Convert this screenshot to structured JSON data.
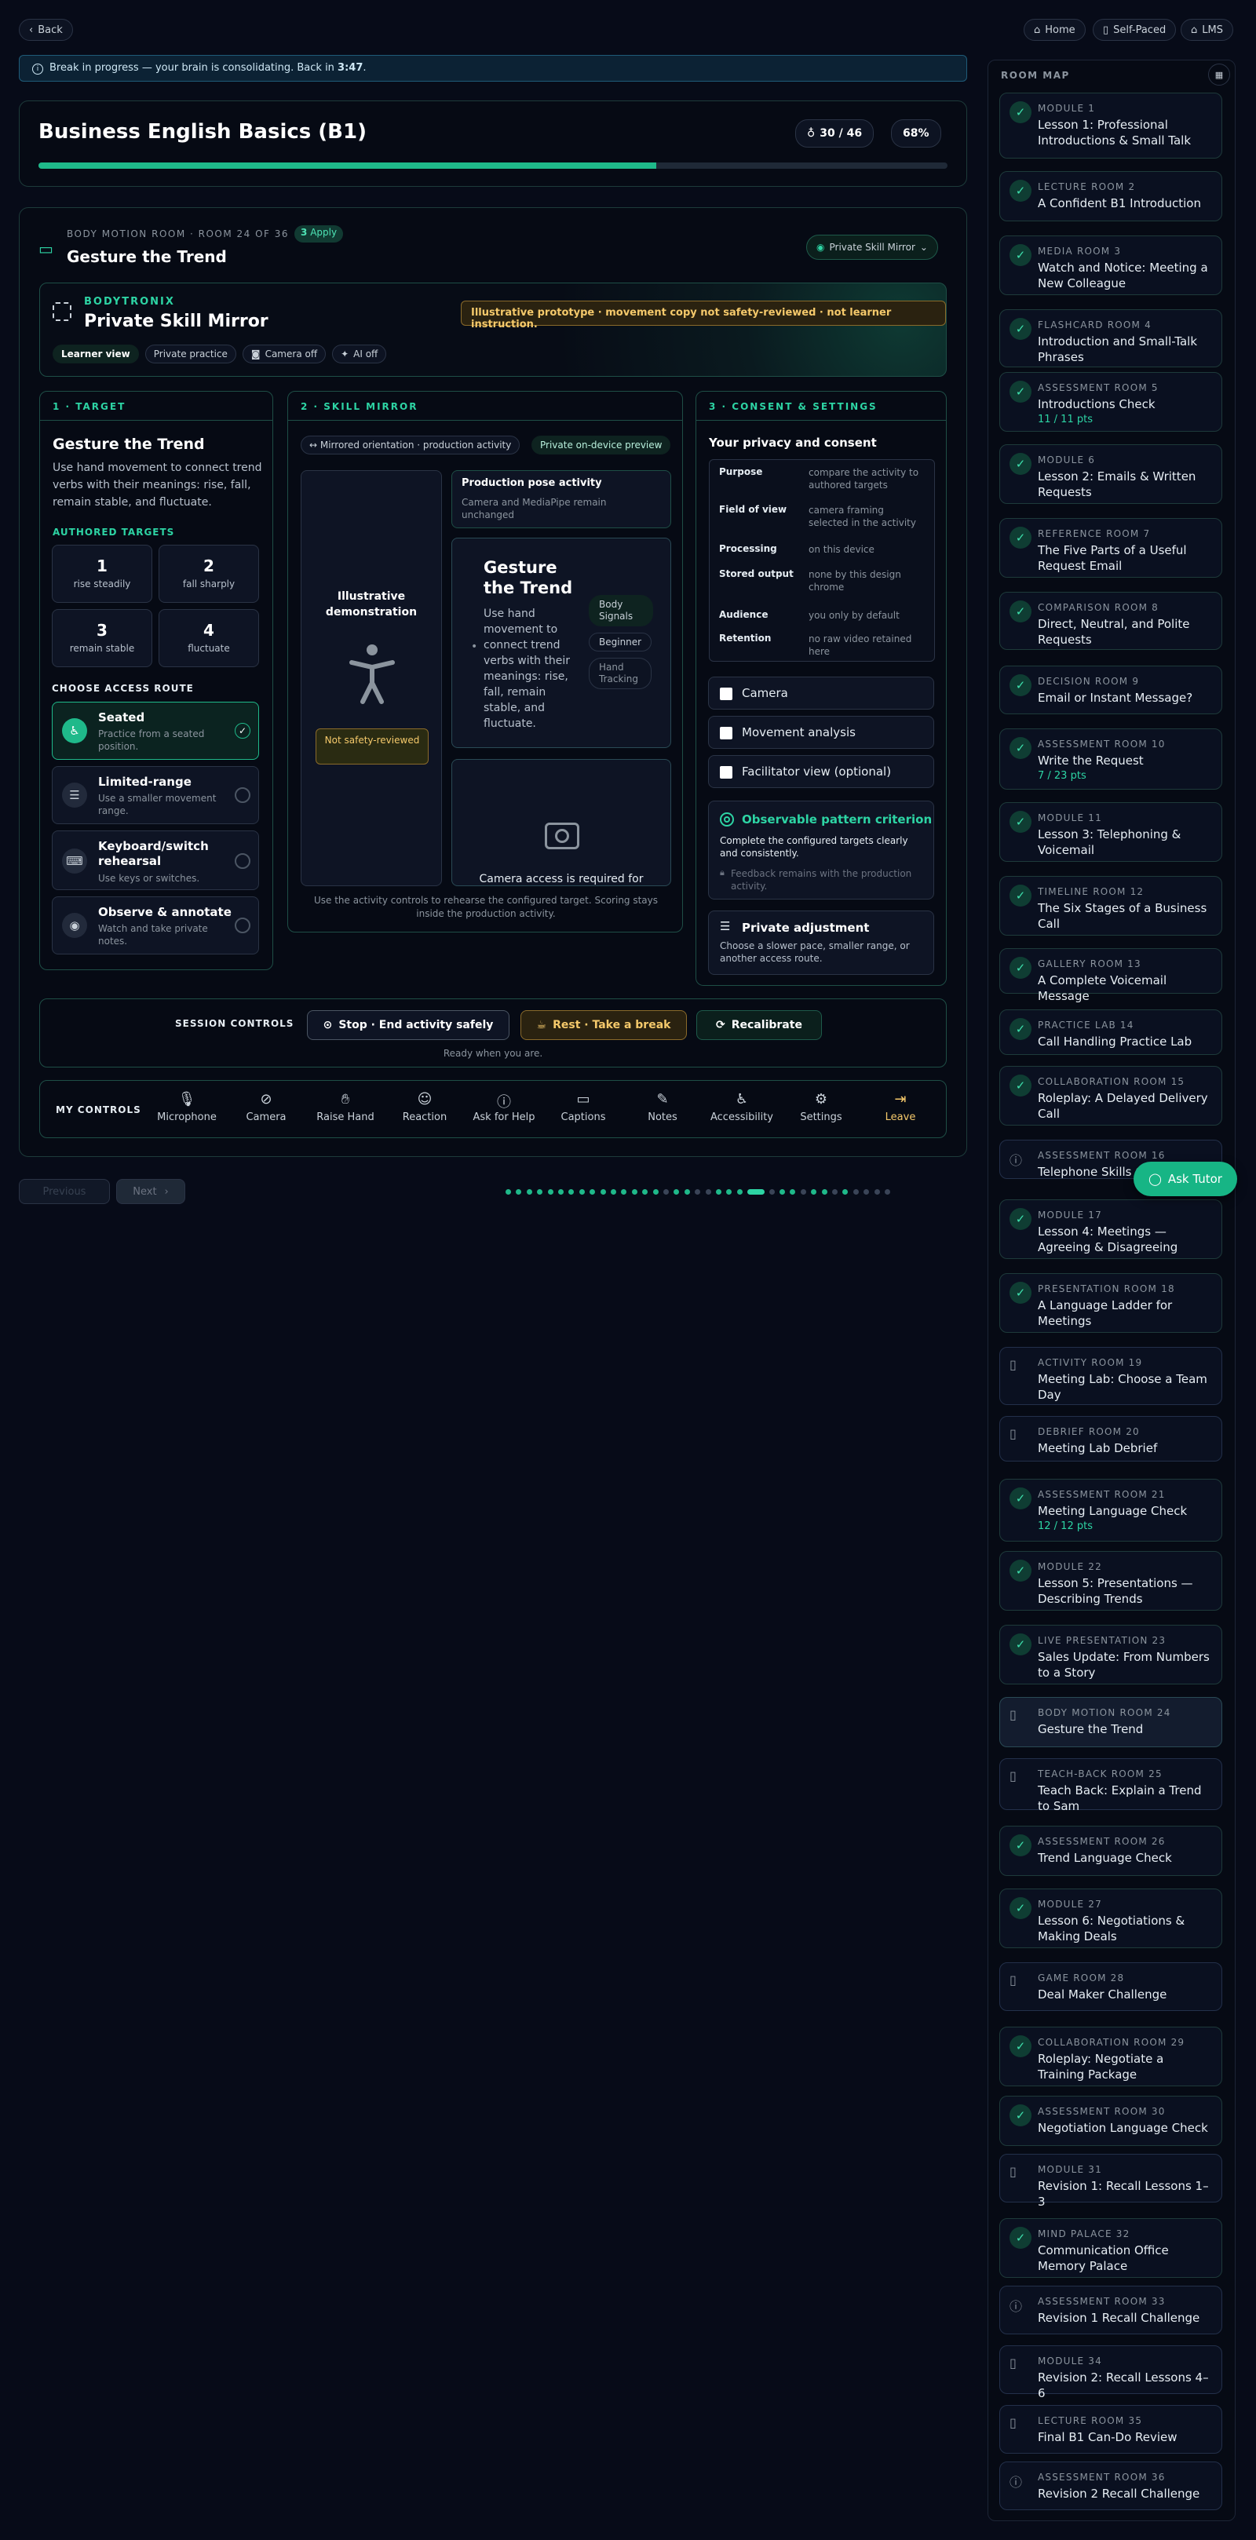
{
  "topnav": {
    "back": "Back",
    "home": "Home",
    "self_paced": "Self-Paced",
    "lms": "LMS"
  },
  "banner": {
    "text": "Break in progress — your brain is consolidating. Back in ",
    "time": "3:47",
    "suffix": "."
  },
  "course": {
    "title": "Business English Basics (B1)",
    "score": "30 / 46",
    "percent": "68%",
    "progress": 0.68
  },
  "room_header": {
    "kicker": "BODY MOTION ROOM · ROOM 24 OF 36",
    "apply_count": "3",
    "apply_label": "Apply",
    "title": "Gesture the Trend",
    "mode_button": "Private Skill Mirror"
  },
  "bodytronix": {
    "brand": "BODYTRONIX",
    "title": "Private Skill Mirror",
    "warning": "Illustrative prototype · movement copy not safety-reviewed · not learner instruction.",
    "tags": [
      "Learner view",
      "Private practice",
      "Camera off",
      "AI off"
    ]
  },
  "target": {
    "heading": "1 · TARGET",
    "title": "Gesture the Trend",
    "desc": "Use hand movement to connect trend verbs with their meanings: rise, fall, remain stable, and fluctuate.",
    "authored_label": "AUTHORED TARGETS",
    "targets": [
      {
        "n": "1",
        "label": "rise steadily"
      },
      {
        "n": "2",
        "label": "fall sharply"
      },
      {
        "n": "3",
        "label": "remain stable"
      },
      {
        "n": "4",
        "label": "fluctuate"
      }
    ],
    "route_label": "CHOOSE ACCESS ROUTE",
    "routes": [
      {
        "title": "Seated",
        "desc": "Practice from a seated position."
      },
      {
        "title": "Limited-range",
        "desc": "Use a smaller movement range."
      },
      {
        "title": "Keyboard/switch rehearsal",
        "desc": "Use keys or switches."
      },
      {
        "title": "Observe & annotate",
        "desc": "Watch and take private notes."
      }
    ]
  },
  "mirror": {
    "heading": "2 · SKILL MIRROR",
    "tag1": "↔ Mirrored orientation · production activity",
    "tag2": "Private on-device preview",
    "demo_label": "Illustrative demonstration",
    "not_reviewed": "Not safety-reviewed",
    "pose_title": "Production pose activity",
    "pose_desc": "Camera and MediaPipe remain unchanged",
    "card_title": "Gesture the Trend",
    "card_desc": "Use hand movement to connect trend verbs with their meanings: rise, fall, remain stable, and fluctuate.",
    "chips": [
      "Body Signals",
      "Beginner",
      "Hand Tracking"
    ],
    "camera_msg": "Camera access is required for",
    "footer": "Use the activity controls to rehearse the configured target. Scoring stays inside the production activity."
  },
  "consent": {
    "heading": "3 · CONSENT & SETTINGS",
    "title": "Your privacy and consent",
    "rows": [
      {
        "k": "Purpose",
        "v": "compare the activity to authored targets"
      },
      {
        "k": "Field of view",
        "v": "camera framing selected in the activity"
      },
      {
        "k": "Processing",
        "v": "on this device"
      },
      {
        "k": "Stored output",
        "v": "none by this design chrome"
      },
      {
        "k": "Audience",
        "v": "you only by default"
      },
      {
        "k": "Retention",
        "v": "no raw video retained here"
      }
    ],
    "checks": [
      "Camera",
      "Movement analysis",
      "Facilitator view (optional)"
    ],
    "criterion_title": "Observable pattern criterion",
    "criterion_desc": "Complete the configured targets clearly and consistently.",
    "criterion_note": "Feedback remains with the production activity.",
    "adjust_title": "Private adjustment",
    "adjust_desc": "Choose a slower pace, smaller range, or another access route."
  },
  "session": {
    "label": "SESSION CONTROLS",
    "stop": "Stop · End activity safely",
    "rest": "Rest · Take a break",
    "recal": "Recalibrate",
    "status": "Ready when you are."
  },
  "controls": {
    "label": "MY CONTROLS",
    "items": [
      "Microphone",
      "Camera",
      "Raise Hand",
      "Reaction",
      "Ask for Help",
      "Captions",
      "Notes",
      "Accessibility",
      "Settings",
      "Leave"
    ]
  },
  "pager": {
    "prev": "Previous",
    "next": "Next"
  },
  "tutor": "Ask Tutor",
  "sidebar": {
    "title": "ROOM MAP",
    "rooms": [
      {
        "k": "MODULE 1",
        "t": "Lesson 1: Professional Introductions & Small Talk"
      },
      {
        "k": "LECTURE ROOM 2",
        "t": "A Confident B1 Introduction"
      },
      {
        "k": "MEDIA ROOM 3",
        "t": "Watch and Notice: Meeting a New Colleague"
      },
      {
        "k": "FLASHCARD ROOM 4",
        "t": "Introduction and Small-Talk Phrases"
      },
      {
        "k": "ASSESSMENT ROOM 5",
        "t": "Introductions Check",
        "p": "11 / 11 pts"
      },
      {
        "k": "MODULE 6",
        "t": "Lesson 2: Emails & Written Requests"
      },
      {
        "k": "REFERENCE ROOM 7",
        "t": "The Five Parts of a Useful Request Email"
      },
      {
        "k": "COMPARISON ROOM 8",
        "t": "Direct, Neutral, and Polite Requests"
      },
      {
        "k": "DECISION ROOM 9",
        "t": "Email or Instant Message?"
      },
      {
        "k": "ASSESSMENT ROOM 10",
        "t": "Write the Request",
        "p": "7 / 23 pts"
      },
      {
        "k": "MODULE 11",
        "t": "Lesson 3: Telephoning & Voicemail"
      },
      {
        "k": "TIMELINE ROOM 12",
        "t": "The Six Stages of a Business Call"
      },
      {
        "k": "GALLERY ROOM 13",
        "t": "A Complete Voicemail Message"
      },
      {
        "k": "PRACTICE LAB 14",
        "t": "Call Handling Practice Lab"
      },
      {
        "k": "COLLABORATION ROOM 15",
        "t": "Roleplay: A Delayed Delivery Call"
      },
      {
        "k": "ASSESSMENT ROOM 16",
        "t": "Telephone Skills Check"
      },
      {
        "k": "MODULE 17",
        "t": "Lesson 4: Meetings — Agreeing & Disagreeing"
      },
      {
        "k": "PRESENTATION ROOM 18",
        "t": "A Language Ladder for Meetings"
      },
      {
        "k": "ACTIVITY ROOM 19",
        "t": "Meeting Lab: Choose a Team Day"
      },
      {
        "k": "DEBRIEF ROOM 20",
        "t": "Meeting Lab Debrief"
      },
      {
        "k": "ASSESSMENT ROOM 21",
        "t": "Meeting Language Check",
        "p": "12 / 12 pts"
      },
      {
        "k": "MODULE 22",
        "t": "Lesson 5: Presentations — Describing Trends"
      },
      {
        "k": "LIVE PRESENTATION 23",
        "t": "Sales Update: From Numbers to a Story"
      },
      {
        "k": "BODY MOTION ROOM 24",
        "t": "Gesture the Trend"
      },
      {
        "k": "TEACH-BACK ROOM 25",
        "t": "Teach Back: Explain a Trend to Sam"
      },
      {
        "k": "ASSESSMENT ROOM 26",
        "t": "Trend Language Check"
      },
      {
        "k": "MODULE 27",
        "t": "Lesson 6: Negotiations & Making Deals"
      },
      {
        "k": "GAME ROOM 28",
        "t": "Deal Maker Challenge"
      },
      {
        "k": "COLLABORATION ROOM 29",
        "t": "Roleplay: Negotiate a Training Package"
      },
      {
        "k": "ASSESSMENT ROOM 30",
        "t": "Negotiation Language Check"
      },
      {
        "k": "MODULE 31",
        "t": "Revision 1: Recall Lessons 1–3"
      },
      {
        "k": "MIND PALACE 32",
        "t": "Communication Office Memory Palace"
      },
      {
        "k": "ASSESSMENT ROOM 33",
        "t": "Revision 1 Recall Challenge"
      },
      {
        "k": "MODULE 34",
        "t": "Revision 2: Recall Lessons 4–6"
      },
      {
        "k": "LECTURE ROOM 35",
        "t": "Final B1 Can-Do Review"
      },
      {
        "k": "ASSESSMENT ROOM 36",
        "t": "Revision 2 Recall Challenge"
      }
    ]
  }
}
